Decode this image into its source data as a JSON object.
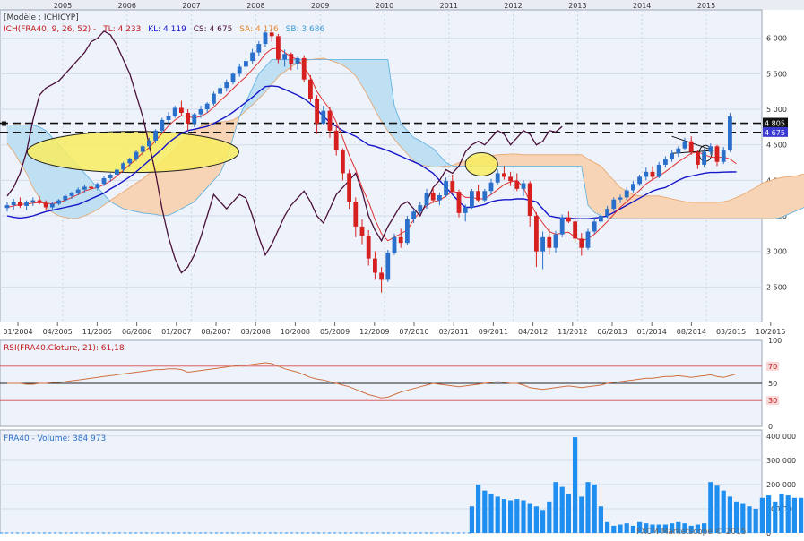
{
  "years": [
    "2005",
    "2006",
    "2007",
    "2008",
    "2009",
    "2010",
    "2011",
    "2012",
    "2013",
    "2014",
    "2015"
  ],
  "price_panel": {
    "model_label": "[Modèle : ICHICYP]",
    "legend": {
      "ich": "ICH(FRA40, 9, 26, 52) -",
      "tl": "TL: 4 233",
      "kl": "KL: 4 119",
      "cs": "CS: 4 675",
      "sa": "SA: 4 176",
      "sb": "SB: 3 686"
    },
    "y_ticks": [
      "6 000",
      "5 500",
      "5 000",
      "4 500",
      "4 000",
      "3 500",
      "3 000",
      "2 500"
    ],
    "y_min": 2000,
    "y_max": 6400,
    "price_tags": [
      {
        "text": "4 805"
      },
      {
        "text": "4 675"
      }
    ],
    "resistance_levels": [
      4805,
      4675
    ]
  },
  "date_axis": [
    "01/2004",
    "04/2005",
    "11/2005",
    "06/2006",
    "01/2007",
    "08/2007",
    "03/2008",
    "10/2008",
    "05/2009",
    "12/2009",
    "07/2010",
    "02/2011",
    "09/2011",
    "04/2012",
    "11/2012",
    "06/2013",
    "01/2014",
    "08/2014",
    "03/2015",
    "10/2015"
  ],
  "rsi_panel": {
    "title": "RSI(FRA40.Cloture, 21): 61,18",
    "levels": [
      "100",
      "70",
      "50",
      "30",
      "0"
    ],
    "last_value": 61.18
  },
  "volume_panel": {
    "title": "FRA40 - Volume: 384 973",
    "ticks": [
      "400 000",
      "300 000",
      "200 000",
      "100 000",
      "0"
    ],
    "watermark": "FXCM Marketscope © 2015",
    "last_value": 384973
  },
  "colors": {
    "up": "#2a6fc9",
    "down": "#d62020",
    "tenkan": "#e03030",
    "kijun": "#1515c8",
    "chikou": "#4a0f3a",
    "cloud_bull": "#f6d4b5",
    "cloud_bear": "#bfe0f2",
    "rsi": "#d07040",
    "volume": "#1e8ff0",
    "ellipse": "#f8ec60"
  },
  "chart_data": {
    "type": "candlestick",
    "instrument": "FRA40",
    "ohlc": [
      [
        3610,
        3700,
        3560,
        3650
      ],
      [
        3650,
        3740,
        3590,
        3700
      ],
      [
        3700,
        3760,
        3610,
        3640
      ],
      [
        3640,
        3720,
        3580,
        3690
      ],
      [
        3690,
        3760,
        3640,
        3720
      ],
      [
        3720,
        3780,
        3660,
        3680
      ],
      [
        3680,
        3720,
        3580,
        3620
      ],
      [
        3620,
        3700,
        3590,
        3670
      ],
      [
        3670,
        3740,
        3650,
        3720
      ],
      [
        3720,
        3800,
        3690,
        3780
      ],
      [
        3780,
        3840,
        3740,
        3820
      ],
      [
        3820,
        3900,
        3790,
        3870
      ],
      [
        3870,
        3940,
        3830,
        3910
      ],
      [
        3910,
        3960,
        3850,
        3890
      ],
      [
        3890,
        3970,
        3860,
        3950
      ],
      [
        3950,
        4060,
        3920,
        4030
      ],
      [
        4030,
        4100,
        3980,
        4080
      ],
      [
        4080,
        4180,
        4050,
        4150
      ],
      [
        4150,
        4260,
        4110,
        4240
      ],
      [
        4240,
        4320,
        4200,
        4300
      ],
      [
        4300,
        4420,
        4270,
        4400
      ],
      [
        4400,
        4500,
        4350,
        4480
      ],
      [
        4480,
        4600,
        4440,
        4560
      ],
      [
        4560,
        4720,
        4520,
        4700
      ],
      [
        4700,
        4880,
        4660,
        4850
      ],
      [
        4850,
        4960,
        4800,
        4900
      ],
      [
        4900,
        5050,
        4880,
        5020
      ],
      [
        5020,
        5120,
        4900,
        4950
      ],
      [
        4950,
        5000,
        4700,
        4800
      ],
      [
        4800,
        4950,
        4750,
        4930
      ],
      [
        4930,
        5050,
        4880,
        5000
      ],
      [
        5000,
        5100,
        4950,
        5080
      ],
      [
        5080,
        5250,
        5050,
        5220
      ],
      [
        5220,
        5350,
        5180,
        5300
      ],
      [
        5300,
        5420,
        5250,
        5380
      ],
      [
        5380,
        5520,
        5350,
        5500
      ],
      [
        5500,
        5640,
        5460,
        5600
      ],
      [
        5600,
        5720,
        5560,
        5680
      ],
      [
        5680,
        5850,
        5640,
        5800
      ],
      [
        5800,
        5960,
        5750,
        5920
      ],
      [
        5920,
        6120,
        5880,
        6080
      ],
      [
        6080,
        6170,
        5950,
        6030
      ],
      [
        6030,
        6060,
        5650,
        5700
      ],
      [
        5700,
        5840,
        5600,
        5780
      ],
      [
        5780,
        5800,
        5550,
        5640
      ],
      [
        5640,
        5740,
        5560,
        5720
      ],
      [
        5720,
        5760,
        5380,
        5420
      ],
      [
        5420,
        5480,
        5100,
        5150
      ],
      [
        5150,
        5200,
        4650,
        4800
      ],
      [
        4800,
        5050,
        4780,
        4980
      ],
      [
        4980,
        5030,
        4600,
        4700
      ],
      [
        4700,
        4780,
        4350,
        4420
      ],
      [
        4420,
        4450,
        4000,
        4100
      ],
      [
        4100,
        4150,
        3600,
        3700
      ],
      [
        3700,
        3760,
        3200,
        3350
      ],
      [
        3350,
        3450,
        3100,
        3220
      ],
      [
        3220,
        3300,
        2800,
        2900
      ],
      [
        2900,
        3000,
        2600,
        2700
      ],
      [
        2700,
        2780,
        2420,
        2600
      ],
      [
        2600,
        3020,
        2570,
        2980
      ],
      [
        2980,
        3250,
        2950,
        3200
      ],
      [
        3200,
        3320,
        3050,
        3120
      ],
      [
        3120,
        3500,
        3090,
        3450
      ],
      [
        3450,
        3600,
        3400,
        3560
      ],
      [
        3560,
        3700,
        3520,
        3650
      ],
      [
        3650,
        3880,
        3600,
        3820
      ],
      [
        3820,
        3900,
        3680,
        3720
      ],
      [
        3720,
        3830,
        3650,
        3790
      ],
      [
        3790,
        4040,
        3760,
        3990
      ],
      [
        3990,
        4080,
        3810,
        3840
      ],
      [
        3840,
        3870,
        3480,
        3540
      ],
      [
        3540,
        3660,
        3420,
        3620
      ],
      [
        3620,
        3880,
        3600,
        3850
      ],
      [
        3850,
        3940,
        3700,
        3720
      ],
      [
        3720,
        3880,
        3690,
        3850
      ],
      [
        3850,
        4020,
        3800,
        3970
      ],
      [
        3970,
        4150,
        3940,
        4100
      ],
      [
        4100,
        4200,
        4010,
        4050
      ],
      [
        4050,
        4120,
        3920,
        3990
      ],
      [
        3990,
        4100,
        3850,
        3880
      ],
      [
        3880,
        4000,
        3780,
        3960
      ],
      [
        3960,
        3990,
        3350,
        3500
      ],
      [
        3500,
        3550,
        2780,
        3000
      ],
      [
        3000,
        3280,
        2750,
        3200
      ],
      [
        3200,
        3320,
        2950,
        3050
      ],
      [
        3050,
        3290,
        2980,
        3240
      ],
      [
        3240,
        3520,
        3200,
        3480
      ],
      [
        3480,
        3560,
        3400,
        3420
      ],
      [
        3420,
        3500,
        3120,
        3180
      ],
      [
        3180,
        3260,
        2940,
        3050
      ],
      [
        3050,
        3320,
        3020,
        3280
      ],
      [
        3280,
        3480,
        3250,
        3420
      ],
      [
        3420,
        3540,
        3380,
        3500
      ],
      [
        3500,
        3640,
        3470,
        3600
      ],
      [
        3600,
        3760,
        3570,
        3730
      ],
      [
        3730,
        3800,
        3680,
        3760
      ],
      [
        3760,
        3900,
        3720,
        3860
      ],
      [
        3860,
        3990,
        3830,
        3950
      ],
      [
        3950,
        4080,
        3920,
        4050
      ],
      [
        4050,
        4180,
        4000,
        4120
      ],
      [
        4120,
        4200,
        4010,
        4050
      ],
      [
        4050,
        4260,
        4030,
        4220
      ],
      [
        4220,
        4340,
        4180,
        4300
      ],
      [
        4300,
        4420,
        4260,
        4380
      ],
      [
        4380,
        4480,
        4330,
        4450
      ],
      [
        4450,
        4600,
        4420,
        4550
      ],
      [
        4550,
        4620,
        4360,
        4400
      ],
      [
        4400,
        4420,
        4160,
        4220
      ],
      [
        4220,
        4450,
        4180,
        4400
      ],
      [
        4400,
        4520,
        4360,
        4480
      ],
      [
        4480,
        4500,
        4200,
        4260
      ],
      [
        4260,
        4470,
        4230,
        4420
      ],
      [
        4420,
        4950,
        4400,
        4900
      ]
    ],
    "tenkan": [
      3620,
      3640,
      3660,
      3665,
      3680,
      3690,
      3680,
      3670,
      3690,
      3720,
      3760,
      3800,
      3850,
      3880,
      3900,
      3940,
      3990,
      4060,
      4140,
      4220,
      4300,
      4390,
      4460,
      4560,
      4660,
      4770,
      4850,
      4910,
      4900,
      4880,
      4900,
      4950,
      5030,
      5120,
      5200,
      5290,
      5380,
      5460,
      5560,
      5660,
      5780,
      5850,
      5860,
      5800,
      5740,
      5700,
      5600,
      5450,
      5250,
      5120,
      5000,
      4820,
      4600,
      4350,
      4150,
      3900,
      3700,
      3450,
      3250,
      3150,
      3200,
      3250,
      3300,
      3450,
      3560,
      3640,
      3700,
      3720,
      3780,
      3850,
      3820,
      3760,
      3760,
      3740,
      3740,
      3800,
      3870,
      3940,
      3980,
      4000,
      3900,
      3700,
      3520,
      3400,
      3280,
      3240,
      3260,
      3270,
      3200,
      3150,
      3180,
      3240,
      3330,
      3420,
      3520,
      3620,
      3700,
      3780,
      3860,
      3950,
      4010,
      4060,
      4120,
      4190,
      4260,
      4320,
      4380,
      4400,
      4360,
      4330,
      4320,
      4330,
      4300,
      4233
    ],
    "kijun": [
      3500,
      3480,
      3470,
      3480,
      3500,
      3530,
      3560,
      3580,
      3600,
      3620,
      3640,
      3660,
      3700,
      3740,
      3780,
      3820,
      3880,
      3930,
      3990,
      4050,
      4120,
      4200,
      4280,
      4360,
      4440,
      4530,
      4600,
      4660,
      4700,
      4720,
      4740,
      4760,
      4800,
      4850,
      4900,
      4960,
      5030,
      5100,
      5170,
      5250,
      5320,
      5330,
      5320,
      5280,
      5240,
      5200,
      5150,
      5080,
      5000,
      4900,
      4820,
      4760,
      4700,
      4660,
      4620,
      4560,
      4500,
      4480,
      4450,
      4420,
      4380,
      4340,
      4300,
      4260,
      4220,
      4160,
      4100,
      4000,
      3900,
      3800,
      3700,
      3620,
      3620,
      3640,
      3660,
      3700,
      3720,
      3730,
      3730,
      3740,
      3740,
      3720,
      3700,
      3600,
      3500,
      3480,
      3470,
      3470,
      3460,
      3460,
      3460,
      3470,
      3480,
      3500,
      3550,
      3600,
      3650,
      3700,
      3750,
      3800,
      3850,
      3880,
      3900,
      3950,
      4000,
      4040,
      4060,
      4080,
      4100,
      4110,
      4110,
      4115,
      4118,
      4119
    ],
    "chikou_start": 0,
    "chikou": [
      3780,
      3900,
      4100,
      4400,
      4850,
      5200,
      5300,
      5350,
      5400,
      5500,
      5600,
      5700,
      5800,
      5950,
      6000,
      6100,
      6050,
      5900,
      5700,
      5500,
      5200,
      4900,
      4500,
      4100,
      3600,
      3200,
      2900,
      2700,
      2780,
      2950,
      3200,
      3500,
      3800,
      3700,
      3600,
      3700,
      3800,
      3750,
      3500,
      3200,
      2950,
      3100,
      3300,
      3500,
      3650,
      3750,
      3850,
      3700,
      3500,
      3400,
      3600,
      3800,
      3900,
      4000,
      4100,
      3850,
      3500,
      3300,
      3150,
      3350,
      3500,
      3650,
      3700,
      3600,
      3500,
      3700,
      3900,
      4000,
      4150,
      4100,
      4200,
      4400,
      4500,
      4550,
      4500,
      4600,
      4700,
      4650,
      4500,
      4600,
      4700,
      4650,
      4500,
      4550,
      4700,
      4680,
      4760
    ],
    "senkou_a": [
      4520,
      4400,
      4250,
      4100,
      3900,
      3750,
      3620,
      3550,
      3500,
      3480,
      3460,
      3470,
      3500,
      3540,
      3590,
      3650,
      3720,
      3780,
      3840,
      3900,
      3960,
      4020,
      4100,
      4180,
      4270,
      4360,
      4440,
      4530,
      4620,
      4700,
      4760,
      4800,
      4810,
      4820,
      4830,
      4850,
      4900,
      4980,
      5060,
      5150,
      5240,
      5350,
      5460,
      5530,
      5600,
      5650,
      5680,
      5700,
      5710,
      5720,
      5690,
      5660,
      5620,
      5560,
      5470,
      5330,
      5170,
      4990,
      4830,
      4690,
      4580,
      4470,
      4370,
      4270,
      4220,
      4200,
      4190,
      4190,
      4200,
      4210,
      4250,
      4270,
      4300,
      4320,
      4340,
      4350,
      4360,
      4365,
      4370,
      4370,
      4360,
      4360,
      4360,
      4360,
      4360,
      4360,
      4360,
      4360,
      4360,
      4360,
      4300,
      4250,
      4200,
      4100,
      4000,
      3900,
      3850,
      3800,
      3780,
      3780,
      3780,
      3780,
      3760,
      3740,
      3720,
      3700,
      3690,
      3690,
      3690,
      3690,
      3690,
      3700,
      3720,
      3760,
      3800,
      3850,
      3900,
      3960,
      3990,
      4020,
      4040,
      4050,
      4060,
      4080,
      4100,
      4130,
      4150,
      4170,
      4176
    ],
    "senkou_b": [
      4780,
      4780,
      4780,
      4780,
      4780,
      4750,
      4700,
      4600,
      4500,
      4400,
      4300,
      4200,
      4100,
      4000,
      3900,
      3800,
      3700,
      3650,
      3600,
      3580,
      3560,
      3540,
      3530,
      3520,
      3500,
      3510,
      3550,
      3600,
      3650,
      3700,
      3800,
      3900,
      4000,
      4100,
      4300,
      4600,
      4900,
      5100,
      5300,
      5500,
      5600,
      5700,
      5700,
      5700,
      5700,
      5700,
      5700,
      5700,
      5700,
      5700,
      5700,
      5700,
      5700,
      5700,
      5700,
      5700,
      5700,
      5700,
      5700,
      5700,
      5050,
      4800,
      4700,
      4600,
      4560,
      4500,
      4450,
      4350,
      4250,
      4200,
      4200,
      4200,
      4200,
      4200,
      4200,
      4200,
      4200,
      4200,
      4200,
      4200,
      4200,
      4200,
      4200,
      4200,
      4200,
      4200,
      4200,
      4200,
      4200,
      4200,
      3650,
      3550,
      3500,
      3480,
      3460,
      3460,
      3460,
      3460,
      3460,
      3460,
      3460,
      3460,
      3460,
      3460,
      3460,
      3460,
      3460,
      3460,
      3460,
      3460,
      3460,
      3460,
      3460,
      3460,
      3460,
      3460,
      3460,
      3460,
      3460,
      3460,
      3480,
      3520,
      3560,
      3600,
      3640,
      3660,
      3670,
      3680,
      3686
    ],
    "rsi": [
      50,
      50,
      50,
      49,
      49,
      50,
      50,
      51,
      51,
      52,
      53,
      54,
      55,
      56,
      57,
      58,
      59,
      60,
      61,
      62,
      63,
      64,
      65,
      66,
      66,
      67,
      67,
      66,
      63,
      64,
      65,
      66,
      67,
      68,
      69,
      70,
      71,
      71,
      72,
      73,
      74,
      73,
      70,
      67,
      65,
      63,
      60,
      57,
      55,
      54,
      52,
      50,
      48,
      46,
      43,
      40,
      37,
      35,
      33,
      34,
      37,
      40,
      42,
      44,
      46,
      48,
      50,
      49,
      48,
      47,
      46,
      47,
      48,
      49,
      50,
      51,
      52,
      51,
      50,
      50,
      48,
      45,
      44,
      43,
      44,
      45,
      46,
      47,
      46,
      45,
      46,
      47,
      48,
      50,
      51,
      52,
      53,
      54,
      55,
      56,
      56,
      57,
      58,
      58,
      59,
      58,
      57,
      58,
      59,
      60,
      58,
      57,
      59,
      61
    ],
    "volume_start": 72,
    "volume": [
      110000,
      200000,
      175000,
      160000,
      150000,
      140000,
      135000,
      140000,
      135000,
      120000,
      110000,
      95000,
      130000,
      210000,
      190000,
      160000,
      395000,
      150000,
      210000,
      200000,
      110000,
      45000,
      30000,
      35000,
      40000,
      30000,
      45000,
      40000,
      35000,
      35000,
      35000,
      40000,
      45000,
      40000,
      30000,
      35000,
      40000,
      210000,
      195000,
      175000,
      150000,
      130000,
      120000,
      110000,
      100000,
      145000,
      155000,
      130000,
      160000,
      155000,
      145000,
      145000,
      120000,
      160000,
      130000,
      110000,
      95000,
      125000,
      175000,
      160000,
      130000,
      150000,
      140000,
      115000,
      105000,
      120000,
      100000,
      100000,
      145000,
      120000,
      115000,
      240000,
      210000,
      384973
    ]
  }
}
